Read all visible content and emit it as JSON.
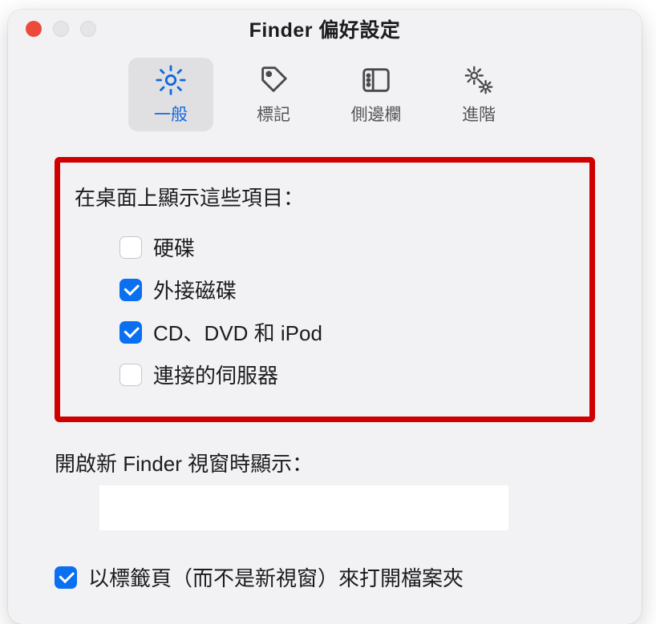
{
  "window": {
    "title": "Finder 偏好設定"
  },
  "tabs": [
    {
      "label": "一般"
    },
    {
      "label": "標記"
    },
    {
      "label": "側邊欄"
    },
    {
      "label": "進階"
    }
  ],
  "desktop_section": {
    "heading": "在桌面上顯示這些項目：",
    "items": [
      {
        "label": "硬碟",
        "checked": false
      },
      {
        "label": "外接磁碟",
        "checked": true
      },
      {
        "label": "CD、DVD 和 iPod",
        "checked": true
      },
      {
        "label": "連接的伺服器",
        "checked": false
      }
    ]
  },
  "new_window": {
    "label": "開啟新 Finder 視窗時顯示："
  },
  "open_in_tabs": {
    "label": "以標籤頁（而不是新視窗）來打開檔案夾",
    "checked": true
  }
}
